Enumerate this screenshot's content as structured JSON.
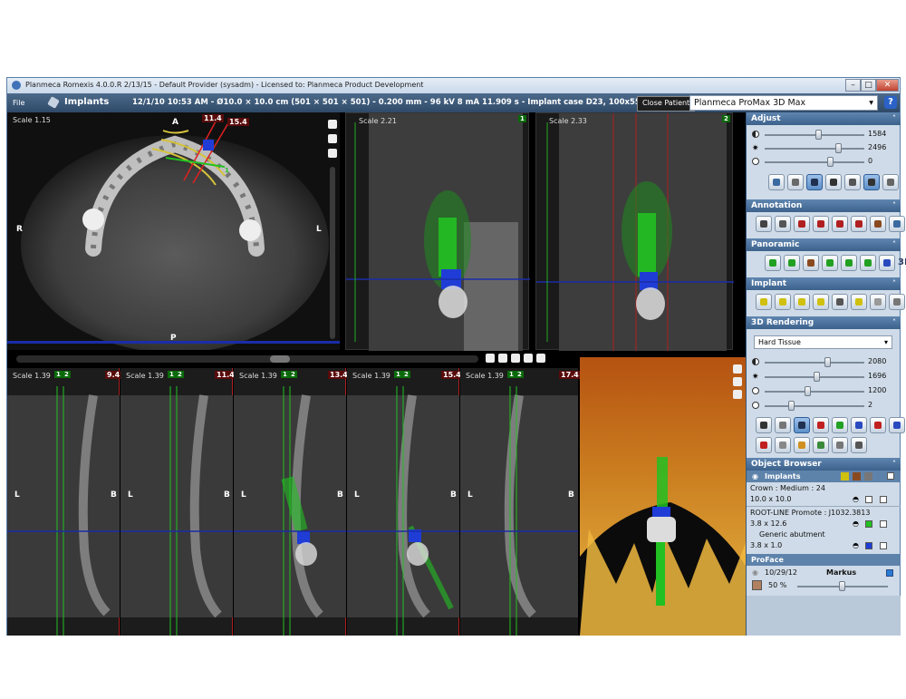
{
  "window": {
    "title": "Planmeca Romexis 4.0.0.R  2/13/15 - Default Provider (sysadm) - Licensed to: Planmeca Product Development",
    "buttons": [
      "–",
      "□",
      "✕"
    ]
  },
  "toolbar": {
    "menu_file": "File",
    "mode": "Implants",
    "info": "12/1/10 10:53 AM - Ø10.0 × 10.0 cm (501 × 501 × 501) - 0.200 mm - 96 kV 8 mA 11.909 s - Implant case D23, 100x55mm",
    "close_patient": "Close Patient",
    "device": "Planmeca ProMax 3D Max",
    "help": "?"
  },
  "axial": {
    "scale": "Scale 1.15",
    "orient": {
      "top": "A",
      "left": "R",
      "right": "L",
      "bottom": "P"
    },
    "tag_a": "11.4",
    "tag_b": "15.4",
    "marker": "1"
  },
  "cross1": {
    "scale": "Scale 2.21",
    "marker": "1"
  },
  "cross2": {
    "scale": "Scale 2.33",
    "marker": "2"
  },
  "slices": [
    {
      "scale": "Scale 1.39",
      "pos": "9.4",
      "m1": "1",
      "m2": "2",
      "L": "L",
      "B": "B"
    },
    {
      "scale": "Scale 1.39",
      "pos": "11.4",
      "m1": "1",
      "m2": "2",
      "L": "L",
      "B": "B"
    },
    {
      "scale": "Scale 1.39",
      "pos": "13.4",
      "m1": "1",
      "m2": "2",
      "L": "L",
      "B": "B"
    },
    {
      "scale": "Scale 1.39",
      "pos": "15.4",
      "m1": "1",
      "m2": "2",
      "L": "L",
      "B": "B"
    },
    {
      "scale": "Scale 1.39",
      "pos": "17.4",
      "m1": "1",
      "m2": "2",
      "L": "L",
      "B": "B"
    }
  ],
  "panel": {
    "adjust": {
      "title": "Adjust",
      "sliders": [
        {
          "value": "1584",
          "level": 0.55
        },
        {
          "value": "2496",
          "level": 0.75
        },
        {
          "value": "0",
          "level": 0.5
        }
      ]
    },
    "annotation": {
      "title": "Annotation"
    },
    "panoramic": {
      "title": "Panoramic",
      "label_3d": "3D"
    },
    "implant": {
      "title": "Implant"
    },
    "rendering": {
      "title": "3D Rendering",
      "preset": "Hard Tissue",
      "sliders": [
        {
          "value": "2080",
          "level": 0.6
        },
        {
          "value": "1696",
          "level": 0.5
        },
        {
          "value": "1200",
          "level": 0.42
        },
        {
          "value": "2",
          "level": 0.25
        }
      ]
    },
    "object_browser": {
      "title": "Object Browser",
      "group": "Implants",
      "items": [
        {
          "name": "Crown : Medium : 24",
          "size": "10.0 x 10.0"
        },
        {
          "name": "ROOT-LINE Promote : J1032.3813",
          "size": "3.8 x 12.6"
        },
        {
          "name": "Generic abutment",
          "size": "3.8 x 1.0"
        }
      ]
    },
    "proface": {
      "title": "ProFace",
      "date": "10/29/12",
      "name": "Markus",
      "opacity": "50 %",
      "level": 0.5
    }
  },
  "colors": {
    "accent": "#3c628c",
    "implant_green": "#22c022",
    "abutment_blue": "#1f3dd6",
    "marker_red": "#e02020"
  }
}
